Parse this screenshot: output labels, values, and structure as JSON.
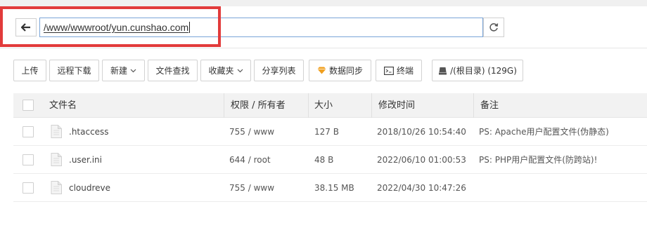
{
  "path_bar": {
    "back_icon": "arrow-left-icon",
    "path_value": "/www/wwwroot/yun.cunshao.com",
    "refresh_icon": "refresh-icon"
  },
  "toolbar": {
    "upload": "上传",
    "remote_download": "远程下载",
    "new": "新建",
    "file_search": "文件查找",
    "favorites": "收藏夹",
    "share_list": "分享列表",
    "data_sync": "数据同步",
    "terminal": "终端",
    "disk": "/(根目录) (129G)"
  },
  "table": {
    "headers": {
      "name": "文件名",
      "perm_owner": "权限 / 所有者",
      "size": "大小",
      "mtime": "修改时间",
      "note": "备注"
    },
    "rows": [
      {
        "name": ".htaccess",
        "perm": "755 / www",
        "size": "127 B",
        "mtime": "2018/10/26 10:54:40",
        "note": "PS: Apache用户配置文件(伪静态)"
      },
      {
        "name": ".user.ini",
        "perm": "644 / root",
        "size": "48 B",
        "mtime": "2022/06/10 01:00:53",
        "note": "PS: PHP用户配置文件(防跨站)!"
      },
      {
        "name": "cloudreve",
        "perm": "755 / www",
        "size": "38.15 MB",
        "mtime": "2022/04/30 10:47:26",
        "note": ""
      }
    ]
  },
  "colors": {
    "highlight": "#e23b3b",
    "input_border": "#7aa5d8",
    "sync_icon": "#f0a020"
  }
}
